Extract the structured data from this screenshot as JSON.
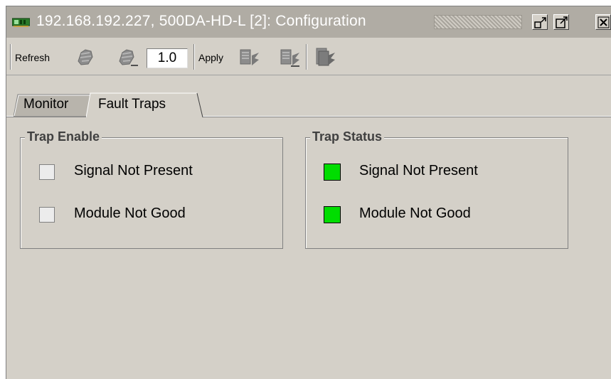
{
  "window": {
    "title": "192.168.192.227, 500DA-HD-L  [2]: Configuration"
  },
  "toolbar": {
    "refresh_label": "Refresh",
    "version_value": "1.0",
    "apply_label": "Apply"
  },
  "tabs": [
    {
      "label": "Monitor",
      "active": false
    },
    {
      "label": "Fault Traps",
      "active": true
    }
  ],
  "trap_enable": {
    "title": "Trap Enable",
    "items": [
      {
        "label": "Signal Not Present",
        "checked": false
      },
      {
        "label": "Module Not Good",
        "checked": false
      }
    ]
  },
  "trap_status": {
    "title": "Trap Status",
    "items": [
      {
        "label": "Signal Not Present",
        "state_color": "#00dd00"
      },
      {
        "label": "Module Not Good",
        "state_color": "#00dd00"
      }
    ]
  },
  "colors": {
    "panel_bg": "#d4d0c8",
    "titlebar_bg": "#b0aca4",
    "status_ok": "#00dd00"
  }
}
